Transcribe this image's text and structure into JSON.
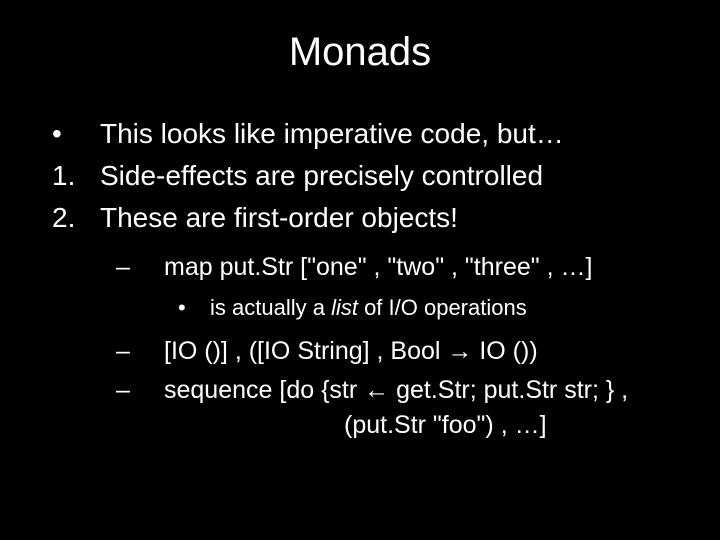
{
  "title": "Monads",
  "bullets": {
    "b1_marker": "•",
    "b1_text": "This looks like imperative code, but…",
    "b2_marker": "1.",
    "b2_text": "Side-effects are precisely controlled",
    "b3_marker": "2.",
    "b3_text": "These are first-order objects!"
  },
  "sub": {
    "s1_marker": "–",
    "s1_text": "map put.Str [\"one\" , \"two\" , \"three\" , …]",
    "s1a_marker": "•",
    "s1a_prefix": "is actually a ",
    "s1a_italic": "list",
    "s1a_suffix": " of I/O operations",
    "s2_marker": "–",
    "s2_text": "[IO ()] , ([IO String] , Bool → IO ())",
    "s3_marker": "–",
    "s3_text": "sequence [do {str ← get.Str; put.Str str; } ,",
    "s3_cont": "(put.Str \"foo\") , …]"
  }
}
